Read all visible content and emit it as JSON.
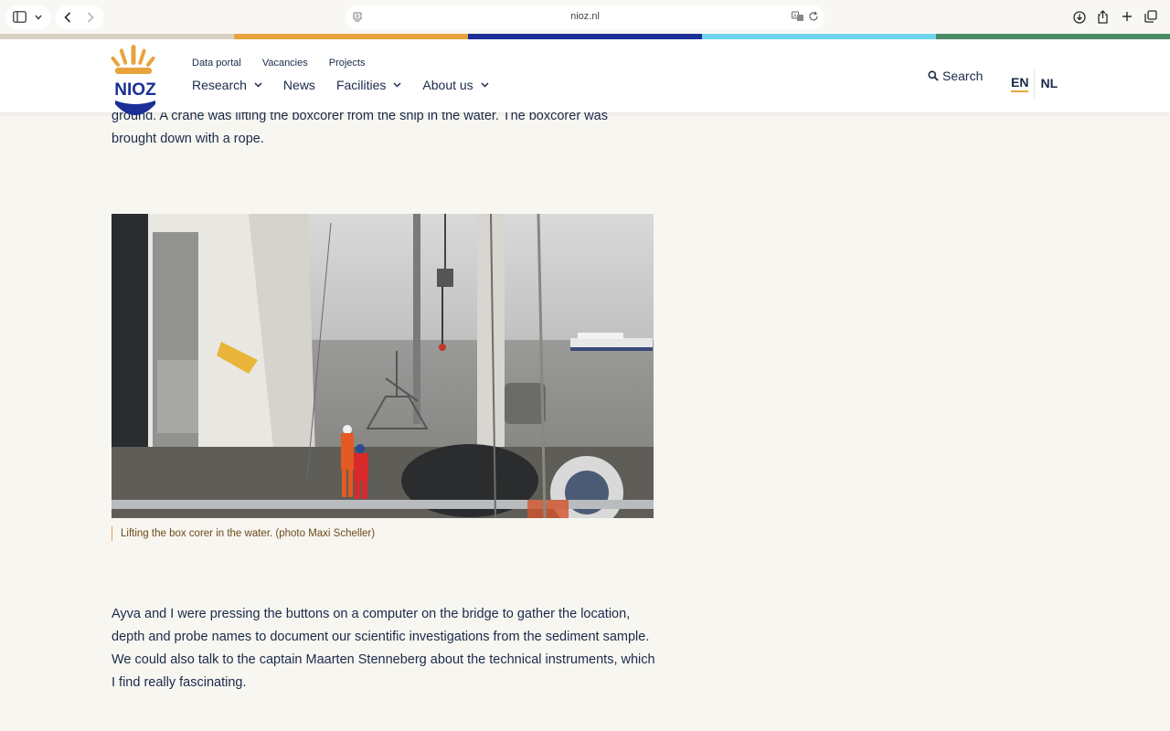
{
  "browser": {
    "url": "nioz.nl",
    "icons": [
      "sidebar-icon",
      "chevron-down-icon",
      "back-icon",
      "forward-icon",
      "page-icon",
      "translate-icon",
      "reload-icon",
      "download-icon",
      "share-icon",
      "plus-icon",
      "tabs-icon"
    ]
  },
  "stripe_colors": [
    "#d7d1c4",
    "#e8a33c",
    "#1a2f97",
    "#6fd6ee",
    "#4a8a66"
  ],
  "header": {
    "logo_text": "NIOZ",
    "util_nav": [
      "Data portal",
      "Vacancies",
      "Projects"
    ],
    "main_nav": [
      {
        "label": "Research",
        "dropdown": true
      },
      {
        "label": "News",
        "dropdown": false
      },
      {
        "label": "Facilities",
        "dropdown": true
      },
      {
        "label": "About us",
        "dropdown": true
      }
    ],
    "search_label": "Search",
    "lang_active": "EN",
    "lang_other": "NL"
  },
  "content": {
    "intro_line1": "ground. A crane was lifting the boxcorer from the ship in the water. The boxcorer was",
    "intro_line2": "brought down with a rope.",
    "caption": "Lifting the box corer in the water. (photo Maxi Scheller)",
    "para2": "Ayva and I were pressing the buttons on a computer on the bridge to gather the location, depth and probe names to document our scientific investigations from the sediment sample. We could also talk to the captain Maarten Stenneberg about the technical instruments, which I find really fascinating."
  },
  "colors": {
    "navy": "#1b2a4a",
    "accent_orange": "#e8a33c",
    "logo_blue": "#1a2f97",
    "page_bg": "#f8f6f1"
  }
}
